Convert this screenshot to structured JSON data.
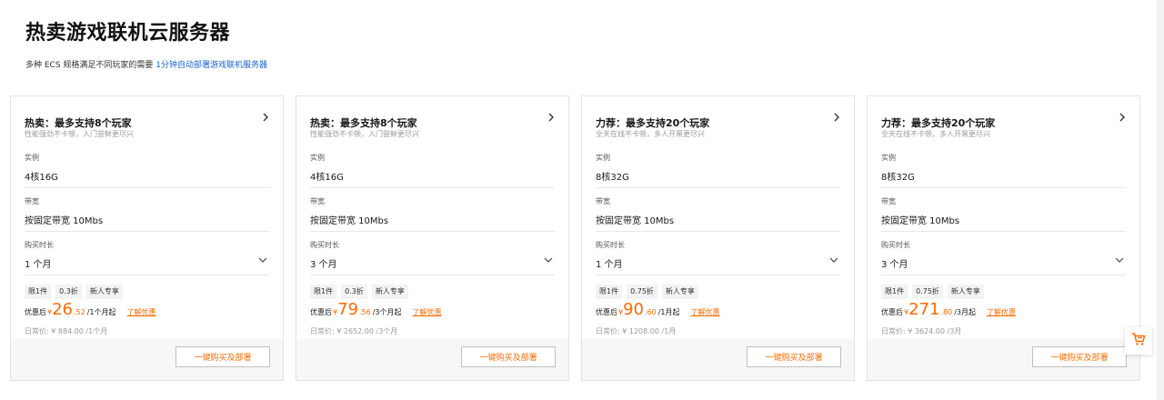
{
  "header": {
    "title": "热卖游戏联机云服务器",
    "subtitle_text": "多种 ECS 规格满足不同玩家的需要",
    "subtitle_link": "1分钟自动部署游戏联机服务器"
  },
  "labels": {
    "instance": "实例",
    "bandwidth": "带宽",
    "duration": "购买时长",
    "price_prefix": "优惠后",
    "currency": "¥",
    "discount_link": "了解优惠",
    "buy_button": "一键购买及部署"
  },
  "colors": {
    "accent": "#ff6a00",
    "link": "#1a62d6"
  },
  "icons": {
    "card_arrow": "chevron-right-icon",
    "dropdown": "chevron-down-icon",
    "float": "shopping-cart-icon"
  },
  "cards": [
    {
      "title": "热卖：最多支持8个玩家",
      "desc": "性能强劲不卡顿，入门尝鲜更尽兴",
      "instance": "4核16G",
      "bandwidth": "按固定带宽 10Mbs",
      "duration": "1 个月",
      "tags": [
        "限1件",
        "0.3折",
        "新人专享"
      ],
      "price_int": "26",
      "price_dec": ".52",
      "price_unit": "/1个月起",
      "regular": "日常价: ¥ 884.00 /1个月"
    },
    {
      "title": "热卖：最多支持8个玩家",
      "desc": "性能强劲不卡顿，入门尝鲜更尽兴",
      "instance": "4核16G",
      "bandwidth": "按固定带宽 10Mbs",
      "duration": "3 个月",
      "tags": [
        "限1件",
        "0.3折",
        "新人专享"
      ],
      "price_int": "79",
      "price_dec": ".56",
      "price_unit": "/3个月起",
      "regular": "日常价: ¥ 2652.00 /3个月"
    },
    {
      "title": "力荐：最多支持20个玩家",
      "desc": "全天在线不卡顿，多人开黑更尽兴",
      "instance": "8核32G",
      "bandwidth": "按固定带宽 10Mbs",
      "duration": "1 个月",
      "tags": [
        "限1件",
        "0.75折",
        "新人专享"
      ],
      "price_int": "90",
      "price_dec": ".60",
      "price_unit": "/1月起",
      "regular": "日常价: ¥ 1208.00 /1月"
    },
    {
      "title": "力荐：最多支持20个玩家",
      "desc": "全天在线不卡顿，多人开黑更尽兴",
      "instance": "8核32G",
      "bandwidth": "按固定带宽 10Mbs",
      "duration": "3 个月",
      "tags": [
        "限1件",
        "0.75折",
        "新人专享"
      ],
      "price_int": "271",
      "price_dec": ".80",
      "price_unit": "/3月起",
      "regular": "日常价: ¥ 3624.00 /3月"
    }
  ]
}
